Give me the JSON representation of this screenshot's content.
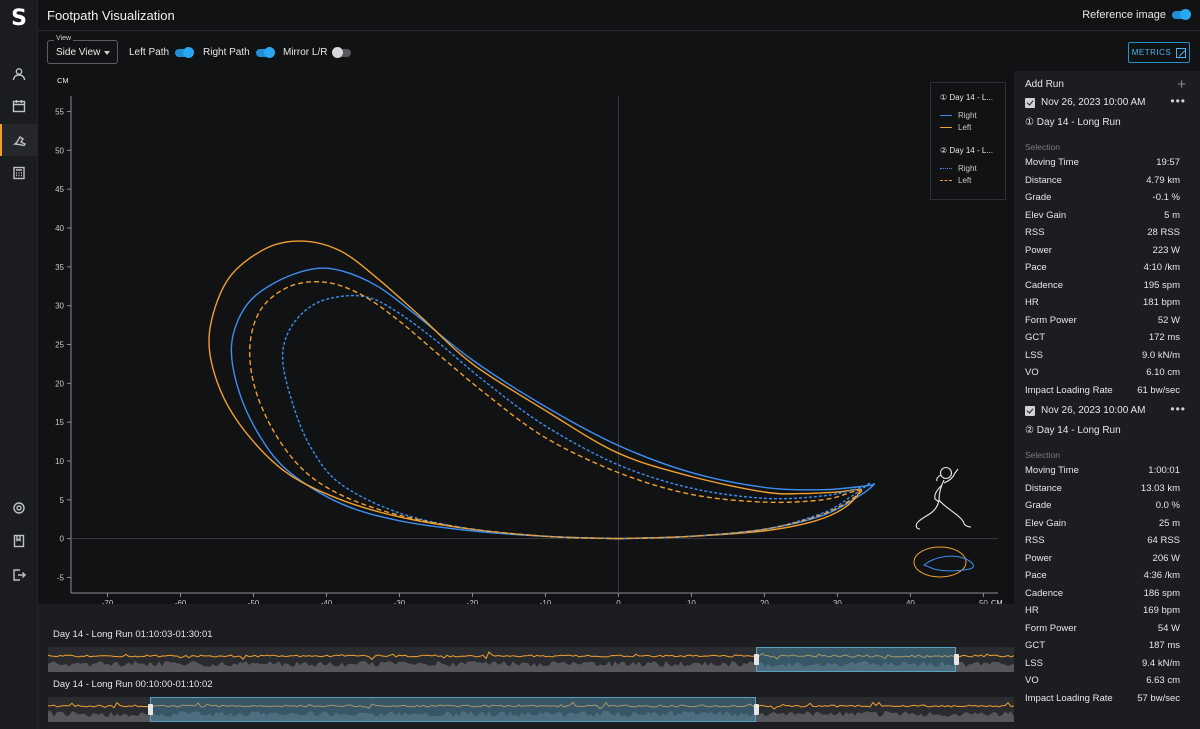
{
  "app": {
    "logo": "S",
    "title": "Footpath Visualization",
    "reference_image_label": "Reference image"
  },
  "nav": [
    {
      "icon": "user-icon"
    },
    {
      "icon": "calendar-icon"
    },
    {
      "icon": "footpath-icon",
      "active": true
    },
    {
      "icon": "calculator-icon"
    }
  ],
  "nav_bottom": [
    {
      "icon": "gear-icon"
    },
    {
      "icon": "book-icon"
    },
    {
      "icon": "logout-icon"
    }
  ],
  "controls": {
    "view_label": "View",
    "view_value": "Side View",
    "left_path_label": "Left Path",
    "left_path_on": true,
    "right_path_label": "Right Path",
    "right_path_on": true,
    "mirror_label": "Mirror L/R",
    "mirror_on": false,
    "metrics_label": "METRICS"
  },
  "legend": {
    "groups": [
      {
        "title": "① Day 14 - L...",
        "entries": [
          {
            "label": "Right",
            "color": "#3d8ef0",
            "style": "solid"
          },
          {
            "label": "Left",
            "color": "#f0a030",
            "style": "solid"
          }
        ]
      },
      {
        "title": "② Day 14 - L...",
        "entries": [
          {
            "label": "Right",
            "color": "#3d8ef0",
            "style": "dotted"
          },
          {
            "label": "Left",
            "color": "#f0a030",
            "style": "dashed"
          }
        ]
      }
    ]
  },
  "chart_data": {
    "type": "line",
    "xlabel": "CM",
    "ylabel": "CM",
    "xlim": [
      -75,
      52
    ],
    "ylim": [
      -7,
      57
    ],
    "x_ticks": [
      -70,
      -60,
      -50,
      -40,
      -30,
      -20,
      -10,
      0,
      10,
      20,
      30,
      40,
      50
    ],
    "y_ticks": [
      -5,
      0,
      5,
      10,
      15,
      20,
      25,
      30,
      35,
      40,
      45,
      50,
      55
    ],
    "series": [
      {
        "name": "Right",
        "run": 1,
        "color": "#3d8ef0",
        "style": "solid",
        "points": [
          [
            0,
            0
          ],
          [
            10,
            0.3
          ],
          [
            20,
            1.2
          ],
          [
            28,
            3.0
          ],
          [
            33,
            5.5
          ],
          [
            35,
            7.0
          ],
          [
            34,
            6.8
          ],
          [
            28,
            6.3
          ],
          [
            20,
            6.6
          ],
          [
            10,
            8.5
          ],
          [
            0,
            12
          ],
          [
            -10,
            17
          ],
          [
            -20,
            23
          ],
          [
            -28,
            29
          ],
          [
            -33,
            32.5
          ],
          [
            -38,
            34.5
          ],
          [
            -42,
            34.7
          ],
          [
            -47,
            33
          ],
          [
            -51,
            30
          ],
          [
            -53,
            25
          ],
          [
            -52,
            19
          ],
          [
            -49,
            13
          ],
          [
            -45,
            8.5
          ],
          [
            -38,
            4.5
          ],
          [
            -30,
            2.3
          ],
          [
            -20,
            1
          ],
          [
            -10,
            0.3
          ],
          [
            0,
            0
          ]
        ]
      },
      {
        "name": "Left",
        "run": 1,
        "color": "#f0a030",
        "style": "solid",
        "points": [
          [
            0,
            0
          ],
          [
            10,
            0.3
          ],
          [
            20,
            1.0
          ],
          [
            27,
            2.3
          ],
          [
            31,
            4.0
          ],
          [
            33,
            6.2
          ],
          [
            30,
            6.0
          ],
          [
            25,
            5.8
          ],
          [
            20,
            6.0
          ],
          [
            10,
            8.0
          ],
          [
            0,
            11
          ],
          [
            -10,
            16.5
          ],
          [
            -20,
            22.5
          ],
          [
            -27,
            28.5
          ],
          [
            -33,
            33.5
          ],
          [
            -38,
            37
          ],
          [
            -43,
            38.3
          ],
          [
            -48,
            37.5
          ],
          [
            -53,
            34
          ],
          [
            -55.5,
            29
          ],
          [
            -56,
            24
          ],
          [
            -54,
            18
          ],
          [
            -50,
            12.5
          ],
          [
            -45,
            8.2
          ],
          [
            -38,
            5
          ],
          [
            -30,
            2.8
          ],
          [
            -20,
            1.2
          ],
          [
            -10,
            0.3
          ],
          [
            0,
            0
          ]
        ]
      },
      {
        "name": "Right",
        "run": 2,
        "color": "#3d8ef0",
        "style": "dotted",
        "points": [
          [
            0,
            0
          ],
          [
            10,
            0.3
          ],
          [
            20,
            1.2
          ],
          [
            28,
            3.3
          ],
          [
            32,
            5.5
          ],
          [
            34.5,
            7.2
          ],
          [
            33,
            6.5
          ],
          [
            28,
            5.5
          ],
          [
            20,
            5.2
          ],
          [
            10,
            6.5
          ],
          [
            0,
            9.5
          ],
          [
            -10,
            14.5
          ],
          [
            -18,
            20
          ],
          [
            -25,
            25.5
          ],
          [
            -30,
            29
          ],
          [
            -34,
            31
          ],
          [
            -38,
            31.2
          ],
          [
            -42,
            30
          ],
          [
            -45,
            27
          ],
          [
            -46,
            23
          ],
          [
            -44.5,
            17
          ],
          [
            -42,
            11.5
          ],
          [
            -38,
            7
          ],
          [
            -30,
            3.3
          ],
          [
            -20,
            1.2
          ],
          [
            -10,
            0.3
          ],
          [
            0,
            0
          ]
        ]
      },
      {
        "name": "Left",
        "run": 2,
        "color": "#f0a030",
        "style": "dashed",
        "points": [
          [
            0,
            0
          ],
          [
            10,
            0.3
          ],
          [
            20,
            1.2
          ],
          [
            27,
            2.8
          ],
          [
            31,
            4.5
          ],
          [
            33.5,
            6.3
          ],
          [
            32,
            6.0
          ],
          [
            28,
            5.0
          ],
          [
            20,
            4.7
          ],
          [
            10,
            5.7
          ],
          [
            0,
            8.5
          ],
          [
            -10,
            13
          ],
          [
            -18,
            18.5
          ],
          [
            -25,
            24
          ],
          [
            -30,
            28
          ],
          [
            -35,
            31.3
          ],
          [
            -40,
            33
          ],
          [
            -45,
            32.5
          ],
          [
            -49,
            29.5
          ],
          [
            -50.5,
            24.5
          ],
          [
            -49.5,
            18.5
          ],
          [
            -46,
            12
          ],
          [
            -41,
            7.2
          ],
          [
            -33,
            3.8
          ],
          [
            -22,
            1.5
          ],
          [
            -10,
            0.3
          ],
          [
            0,
            0
          ]
        ]
      }
    ]
  },
  "panel": {
    "add_run_label": "Add Run",
    "runs": [
      {
        "date": "Nov 26, 2023 10:00 AM",
        "name": "① Day 14 - Long Run",
        "selection_label": "Selection",
        "metrics": [
          {
            "label": "Moving Time",
            "value": "19:57"
          },
          {
            "label": "Distance",
            "value": "4.79 km"
          },
          {
            "label": "Grade",
            "value": "-0.1 %"
          },
          {
            "label": "Elev Gain",
            "value": "5 m"
          },
          {
            "label": "RSS",
            "value": "28 RSS"
          },
          {
            "label": "Power",
            "value": "223 W"
          },
          {
            "label": "Pace",
            "value": "4:10 /km"
          },
          {
            "label": "Cadence",
            "value": "195 spm"
          },
          {
            "label": "HR",
            "value": "181 bpm"
          },
          {
            "label": "Form Power",
            "value": "52 W"
          },
          {
            "label": "GCT",
            "value": "172 ms"
          },
          {
            "label": "LSS",
            "value": "9.0 kN/m"
          },
          {
            "label": "VO",
            "value": "6.10 cm"
          },
          {
            "label": "Impact Loading Rate",
            "value": "61 bw/sec"
          }
        ]
      },
      {
        "date": "Nov 26, 2023 10:00 AM",
        "name": "② Day 14 - Long Run",
        "selection_label": "Selection",
        "metrics": [
          {
            "label": "Moving Time",
            "value": "1:00:01"
          },
          {
            "label": "Distance",
            "value": "13.03 km"
          },
          {
            "label": "Grade",
            "value": "0.0 %"
          },
          {
            "label": "Elev Gain",
            "value": "25 m"
          },
          {
            "label": "RSS",
            "value": "64 RSS"
          },
          {
            "label": "Power",
            "value": "206 W"
          },
          {
            "label": "Pace",
            "value": "4:36 /km"
          },
          {
            "label": "Cadence",
            "value": "186 spm"
          },
          {
            "label": "HR",
            "value": "169 bpm"
          },
          {
            "label": "Form Power",
            "value": "54 W"
          },
          {
            "label": "GCT",
            "value": "187 ms"
          },
          {
            "label": "LSS",
            "value": "9.4 kN/m"
          },
          {
            "label": "VO",
            "value": "6.63 cm"
          },
          {
            "label": "Impact Loading Rate",
            "value": "57 bw/sec"
          }
        ]
      }
    ]
  },
  "timeline": [
    {
      "label": "Day 14 - Long Run  01:10:03-01:30:01",
      "sel_start": 0.733,
      "sel_end": 0.94
    },
    {
      "label": "Day 14 - Long Run  00:10:00-01:10:02",
      "sel_start": 0.106,
      "sel_end": 0.733
    }
  ]
}
